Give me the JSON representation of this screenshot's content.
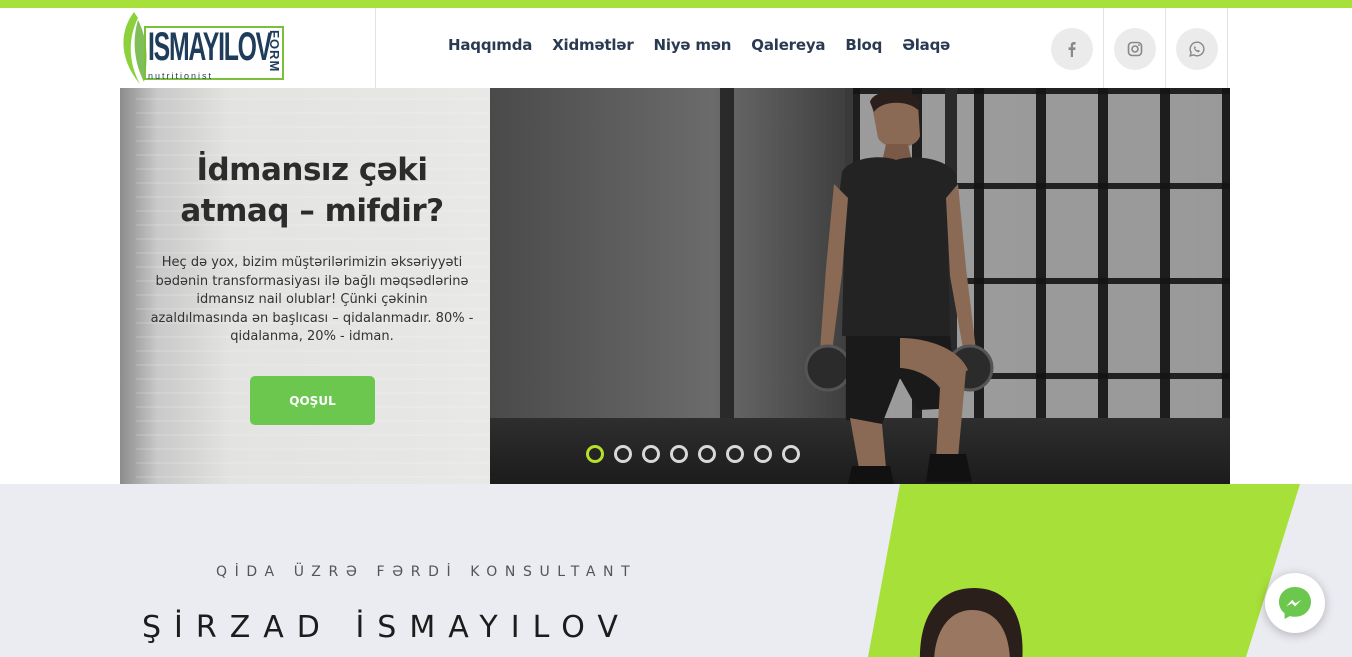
{
  "brand": {
    "logo_main": "ISMAYILOV",
    "logo_side": "FORM",
    "logo_sub": "nutritionist"
  },
  "nav": {
    "items": [
      "Haqqımda",
      "Xidmətlər",
      "Niyə mən",
      "Qalereya",
      "Bloq",
      "Əlaqə"
    ]
  },
  "social": {
    "icons": [
      "facebook-icon",
      "instagram-icon",
      "whatsapp-icon"
    ]
  },
  "hero": {
    "title_line1": "İdmansız çəki",
    "title_line2": "atmaq – mifdir?",
    "text": "Heç də yox, bizim müştərilərimizin əksəriyyəti bədənin transformasiyası ilə bağlı məqsədlərinə idmansız nail olublar! Çünki çəkinin azaldılmasında ən başlıcası – qidalanmadır. 80% - qidalanma, 20% - idman.",
    "cta_label": "QOŞUL",
    "slide_count": 8,
    "active_slide": 1
  },
  "about": {
    "subtitle": "QİDA ÜZRƏ FƏRDİ KONSULTANT",
    "name": "ŞİRZAD İSMAYILOV"
  },
  "colors": {
    "accent": "#a8e03a",
    "button": "#6cc74f",
    "nav_text": "#2a3a52",
    "section_bg": "#ebebf2"
  },
  "floating": {
    "icon": "messenger-icon"
  }
}
